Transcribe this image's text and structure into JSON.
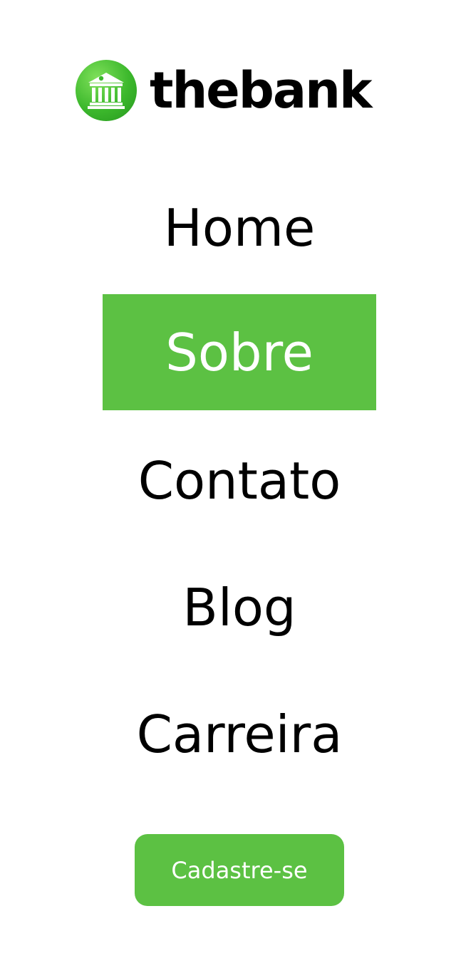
{
  "brand": {
    "name": "thebank",
    "icon": "bank-building-icon"
  },
  "nav": {
    "items": [
      {
        "label": "Home",
        "active": false
      },
      {
        "label": "Sobre",
        "active": true
      },
      {
        "label": "Contato",
        "active": false
      },
      {
        "label": "Blog",
        "active": false
      },
      {
        "label": "Carreira",
        "active": false
      }
    ]
  },
  "cta": {
    "label": "Cadastre-se"
  },
  "colors": {
    "accent": "#5cc143",
    "text": "#000000",
    "background": "#ffffff"
  }
}
